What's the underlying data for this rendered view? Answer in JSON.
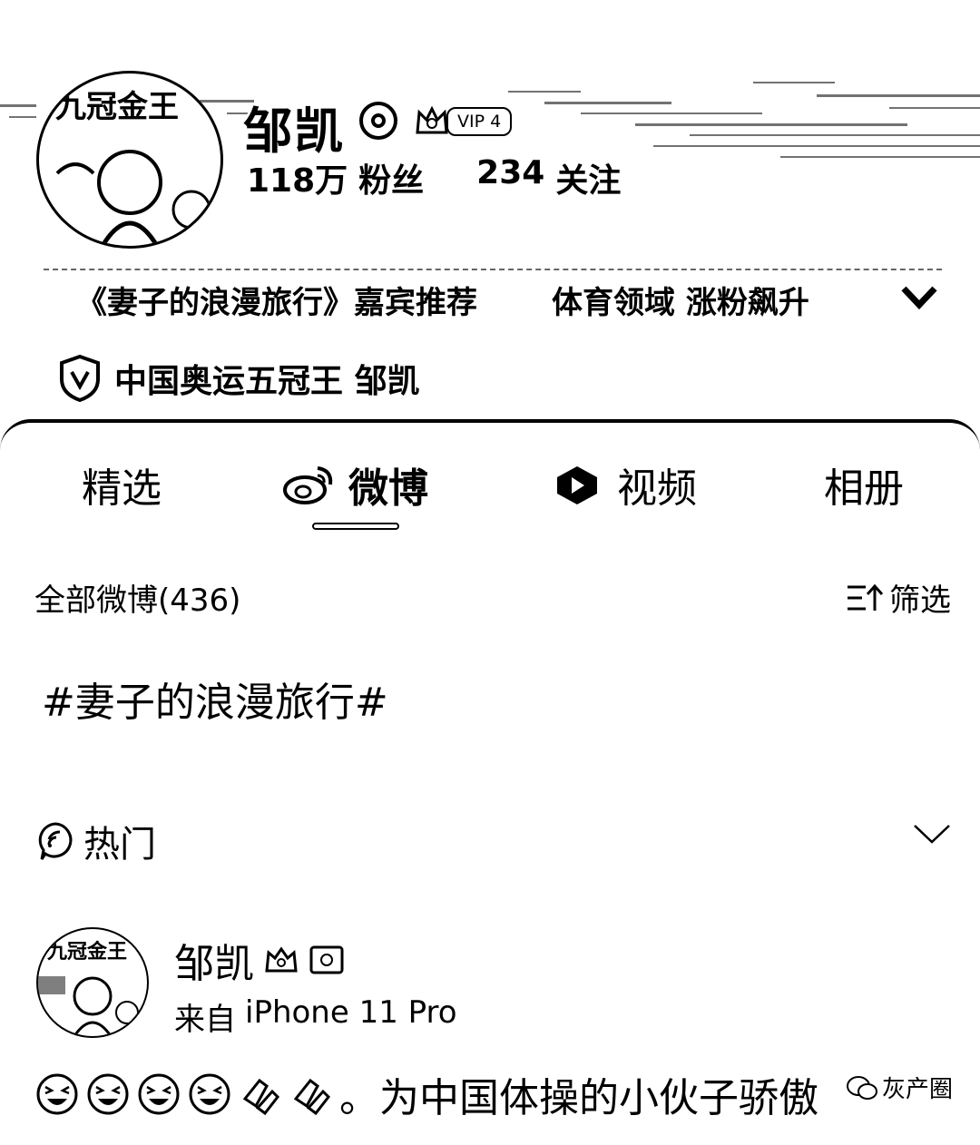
{
  "profile": {
    "name": "邹凯",
    "vip_label": "VIP 4",
    "followers_count": "118万",
    "followers_label": "粉丝",
    "following_count": "234",
    "following_label": "关注",
    "avatar_text": "九冠金王",
    "tags": [
      "《妻子的浪漫旅行》嘉宾推荐",
      "体育领域 涨粉飙升"
    ],
    "certification": "中国奥运五冠王 邹凯"
  },
  "tabs": [
    {
      "label": "精选"
    },
    {
      "label": "微博"
    },
    {
      "label": "视频"
    },
    {
      "label": "相册"
    }
  ],
  "feed": {
    "all_label": "全部微博(436)",
    "filter_label": "筛选",
    "topic": "#妻子的浪漫旅行#",
    "hot_label": "热门"
  },
  "post": {
    "author": "邹凯",
    "source_prefix": "来自",
    "source_device": "iPhone 11 Pro",
    "text": "。为中国体操的小伙子骄傲",
    "emoji_icons": [
      "laughing-crying-face",
      "laughing-crying-face",
      "laughing-crying-face",
      "laughing-crying-face",
      "clapping-hands",
      "clapping-hands"
    ]
  },
  "watermark": "灰产圈"
}
